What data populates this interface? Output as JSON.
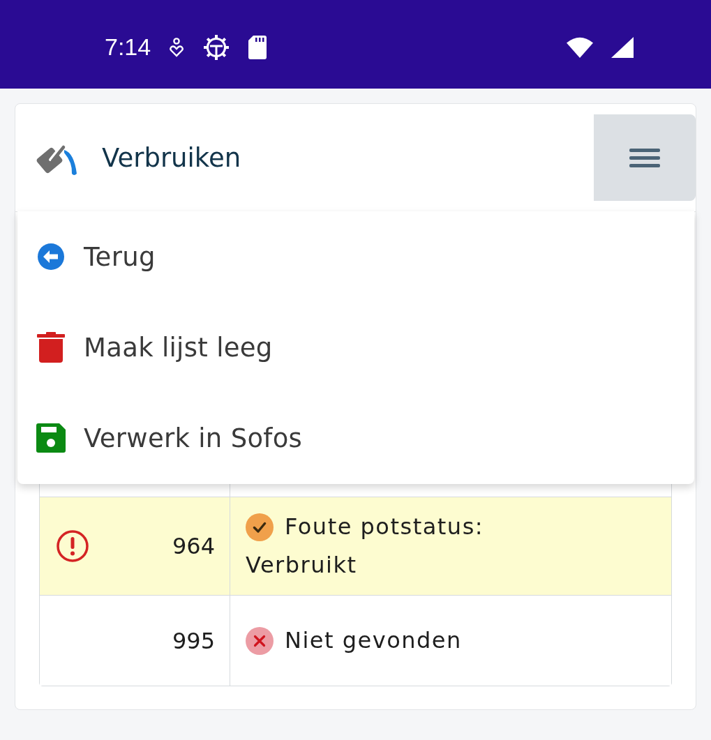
{
  "status_bar": {
    "time": "7:14"
  },
  "header": {
    "title": "Verbruiken",
    "menu_expanded": true
  },
  "menu": {
    "items": [
      {
        "label": "Terug",
        "kind": "back"
      },
      {
        "label": "Maak lijst leeg",
        "kind": "clear"
      },
      {
        "label": "Verwerk in Sofos",
        "kind": "save"
      }
    ]
  },
  "table": {
    "rows": [
      {
        "warning": true,
        "number": "964",
        "status": {
          "kind": "check",
          "text": "Foute potstatus:",
          "detail": "Verbruikt"
        }
      },
      {
        "warning": false,
        "number": "995",
        "status": {
          "kind": "cross",
          "text": "Niet gevonden"
        }
      }
    ]
  }
}
